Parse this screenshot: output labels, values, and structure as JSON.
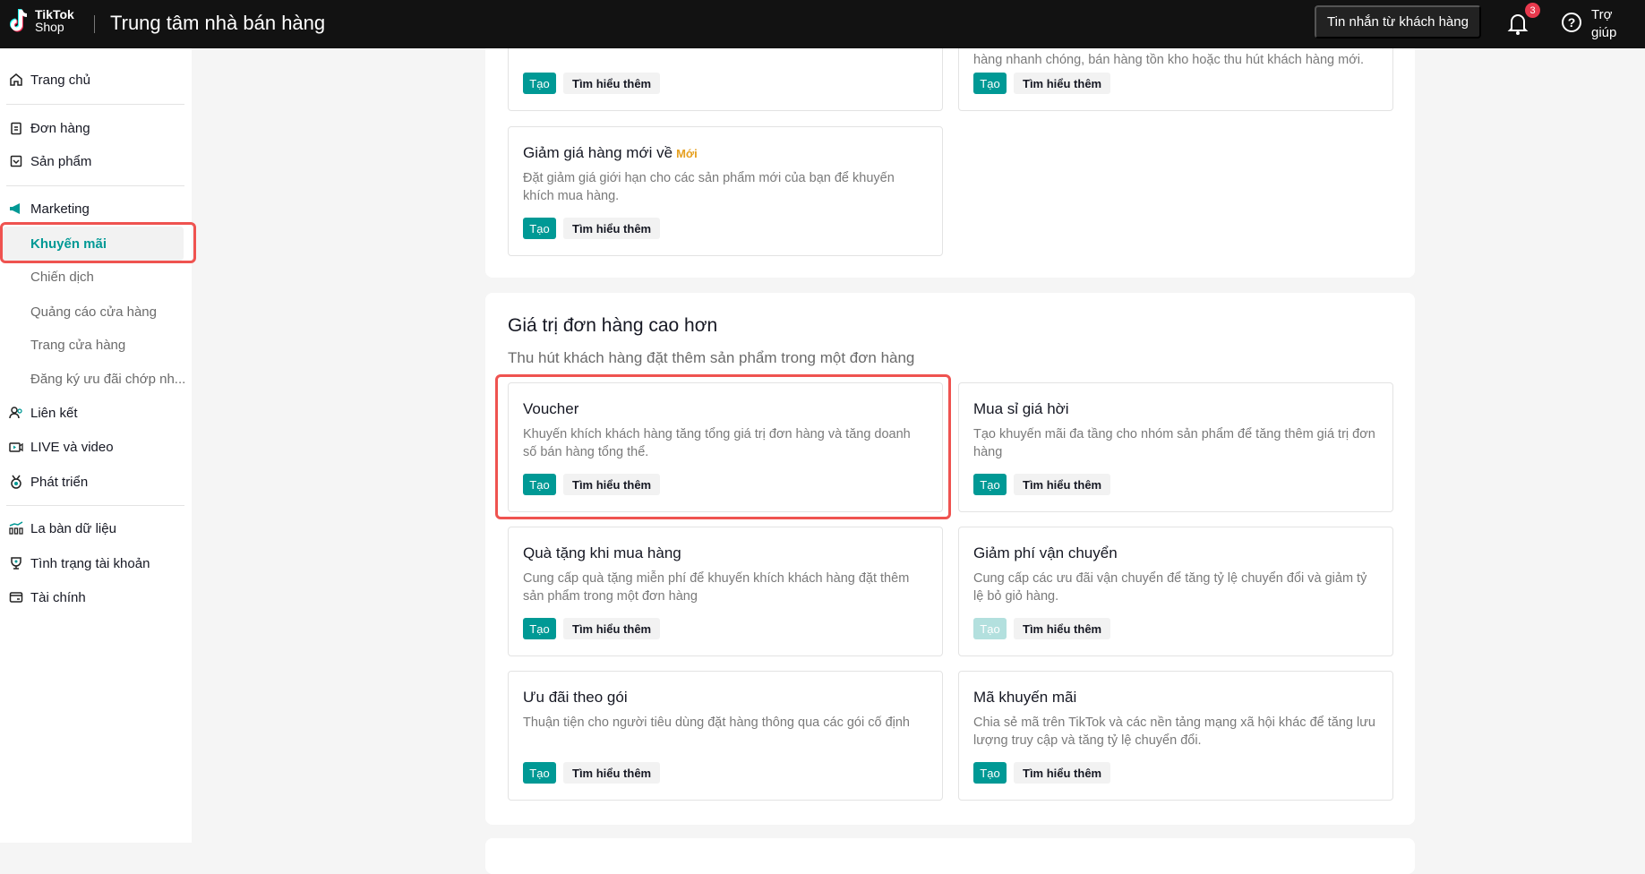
{
  "header": {
    "logo_line1": "TikTok",
    "logo_line2": "Shop",
    "title": "Trung tâm nhà bán hàng",
    "messages_button": "Tin nhắn từ khách hàng",
    "notification_count": "3",
    "help_line1": "Trợ",
    "help_line2": "giúp"
  },
  "sidebar": {
    "home": "Trang chủ",
    "orders": "Đơn hàng",
    "products": "Sản phẩm",
    "marketing": "Marketing",
    "promotions": "Khuyến mãi",
    "campaigns": "Chiến dịch",
    "store_ads": "Quảng cáo cửa hàng",
    "storefront": "Trang cửa hàng",
    "flash_deals": "Đăng ký ưu đãi chớp nh...",
    "affiliate": "Liên kết",
    "live_video": "LIVE và video",
    "growth": "Phát triển",
    "data_compass": "La bàn dữ liệu",
    "account_health": "Tình trạng tài khoản",
    "finance": "Tài chính"
  },
  "buttons": {
    "create": "Tạo",
    "learn_more": "Tìm hiểu thêm"
  },
  "top_section": {
    "cards": [
      {
        "title": "",
        "desc": ""
      },
      {
        "title": "",
        "desc": "hàng nhanh chóng, bán hàng tồn kho hoặc thu hút khách hàng mới."
      },
      {
        "title": "Giảm giá hàng mới về",
        "badge": "Mới",
        "desc": "Đặt giảm giá giới hạn cho các sản phẩm mới của bạn để khuyến khích mua hàng."
      }
    ]
  },
  "order_value_section": {
    "title": "Giá trị đơn hàng cao hơn",
    "subtitle": "Thu hút khách hàng đặt thêm sản phẩm trong một đơn hàng",
    "cards": [
      {
        "title": "Voucher",
        "desc": "Khuyến khích khách hàng tăng tổng giá trị đơn hàng và tăng doanh số bán hàng tổng thể."
      },
      {
        "title": "Mua sỉ giá hời",
        "desc": "Tạo khuyến mãi đa tầng cho nhóm sản phẩm để tăng thêm giá trị đơn hàng"
      },
      {
        "title": "Quà tặng khi mua hàng",
        "desc": "Cung cấp quà tặng miễn phí để khuyến khích khách hàng đặt thêm sản phẩm trong một đơn hàng"
      },
      {
        "title": "Giảm phí vận chuyển",
        "desc": "Cung cấp các ưu đãi vận chuyển để tăng tỷ lệ chuyển đổi và giảm tỷ lệ bỏ giỏ hàng.",
        "create_disabled": true
      },
      {
        "title": "Ưu đãi theo gói",
        "desc": "Thuận tiện cho người tiêu dùng đặt hàng thông qua các gói cố định"
      },
      {
        "title": "Mã khuyến mãi",
        "desc": "Chia sẻ mã trên TikTok và các nền tảng mạng xã hội khác để tăng lưu lượng truy cập và tăng tỷ lệ chuyển đổi."
      }
    ]
  },
  "colors": {
    "accent": "#009995",
    "highlight": "#ef5350",
    "badge_new": "#e6a020"
  }
}
